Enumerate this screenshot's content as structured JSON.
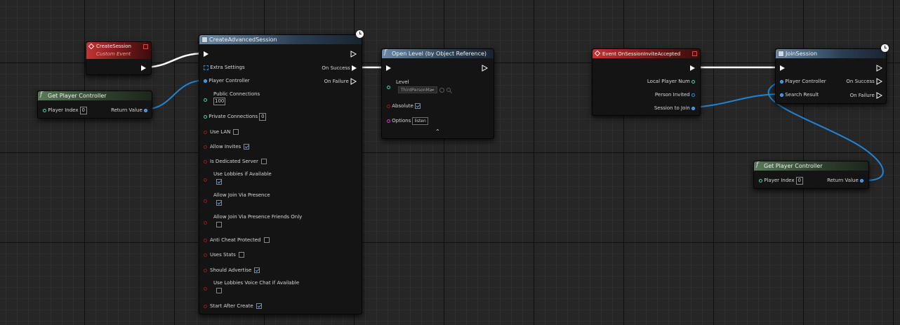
{
  "nodes": {
    "create_session_event": {
      "title": "CreateSession",
      "subtitle": "Custom Event"
    },
    "get_player_controller_1": {
      "title": "Get Player Controller",
      "player_index_label": "Player Index",
      "player_index_value": "0",
      "return_value_label": "Return Value"
    },
    "create_advanced_session": {
      "title": "CreateAdvancedSession",
      "on_success": "On Success",
      "on_failure": "On Failure",
      "pins": {
        "extra_settings": "Extra Settings",
        "player_controller": "Player Controller",
        "public_connections": "Public Connections",
        "public_connections_value": "100",
        "private_connections": "Private Connections",
        "private_connections_value": "0",
        "use_lan": "Use LAN",
        "allow_invites": "Allow Invites",
        "is_dedicated_server": "Is Dedicated Server",
        "use_lobbies": "Use Lobbies if Available",
        "allow_join_presence": "Allow Join Via Presence",
        "allow_join_presence_friends": "Allow Join Via Presence Friends Only",
        "anti_cheat": "Anti Cheat Protected",
        "uses_stats": "Uses Stats",
        "should_advertise": "Should Advertise",
        "use_lobbies_voice": "Use Lobbies Voice Chat if Available",
        "start_after_create": "Start After Create"
      },
      "checks": {
        "use_lan": false,
        "allow_invites": true,
        "is_dedicated_server": false,
        "use_lobbies": true,
        "allow_join_presence": true,
        "allow_join_presence_friends": false,
        "anti_cheat": false,
        "uses_stats": false,
        "should_advertise": true,
        "use_lobbies_voice": false,
        "start_after_create": true
      }
    },
    "open_level": {
      "title": "Open Level (by Object Reference)",
      "level_label": "Level",
      "level_value": "ThirdPersonMa",
      "absolute_label": "Absolute",
      "options_label": "Options",
      "options_value": "listen"
    },
    "event_invite": {
      "title": "Event OnSessionInviteAccepted",
      "local_player_num": "Local Player Num",
      "person_invited": "Person Invited",
      "session_to_join": "Session to Join"
    },
    "join_session": {
      "title": "JoinSession",
      "player_controller": "Player Controller",
      "search_result": "Search Result",
      "on_success": "On Success",
      "on_failure": "On Failure"
    },
    "get_player_controller_2": {
      "title": "Get Player Controller",
      "player_index_label": "Player Index",
      "player_index_value": "0",
      "return_value_label": "Return Value"
    }
  },
  "colors": {
    "exec": "#ffffff",
    "object_pin": "#2b8ae8",
    "int_pin": "#3bd8b0",
    "bool_pin": "#a01818",
    "string_pin": "#e030e0",
    "event_header": "#c23434",
    "function_header": "#6a8aa8",
    "pure_header": "#5a7a58"
  },
  "icons": {
    "event": "event-diamond-icon",
    "function": "function-f-icon",
    "latent": "clock-icon"
  }
}
